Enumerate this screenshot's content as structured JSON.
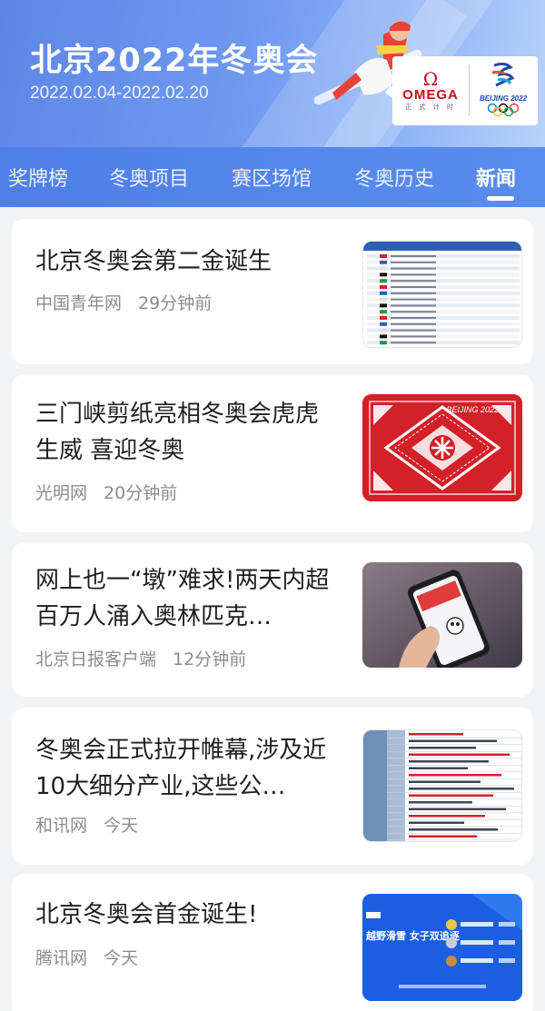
{
  "header": {
    "title": "北京2022年冬奥会",
    "dates": "2022.02.04-2022.02.20",
    "sponsor_symbol": "Ω",
    "sponsor_name": "OMEGA",
    "sponsor_sub": "正 式 计 时",
    "games_logo_text": "BEIJING 2022"
  },
  "tabs": [
    {
      "label": "奖牌榜",
      "active": false
    },
    {
      "label": "冬奥项目",
      "active": false
    },
    {
      "label": "赛区场馆",
      "active": false
    },
    {
      "label": "冬奥历史",
      "active": false
    },
    {
      "label": "新闻",
      "active": true
    }
  ],
  "news": [
    {
      "title": "北京冬奥会第二金诞生",
      "source": "中国青年网",
      "time": "29分钟前",
      "thumb": "results-table-image"
    },
    {
      "title": "三门峡剪纸亮相冬奥会虎虎生威 喜迎冬奥",
      "source": "光明网",
      "time": "20分钟前",
      "thumb": "red-papercut-image",
      "thumb_text": "BEIJING 2022"
    },
    {
      "title": "网上也一“墩”难求!两天内超百万人涌入奥林匹克…",
      "source": "北京日报客户端",
      "time": "12分钟前",
      "thumb": "phone-photo-image"
    },
    {
      "title": "冬奥会正式拉开帷幕,涉及近10大细分产业,这些公…",
      "source": "和讯网",
      "time": "今天",
      "thumb": "industry-table-image"
    },
    {
      "title": "北京冬奥会首金诞生!",
      "source": "腾讯网",
      "time": "今天",
      "thumb": "blue-poster-image",
      "thumb_text": "越野滑雪 女子双追逐"
    }
  ],
  "colors": {
    "banner_start": "#5d86e8",
    "tab_bar": "#5082e8",
    "papercut_red": "#d8232a",
    "poster_blue": "#1b5fe0"
  }
}
